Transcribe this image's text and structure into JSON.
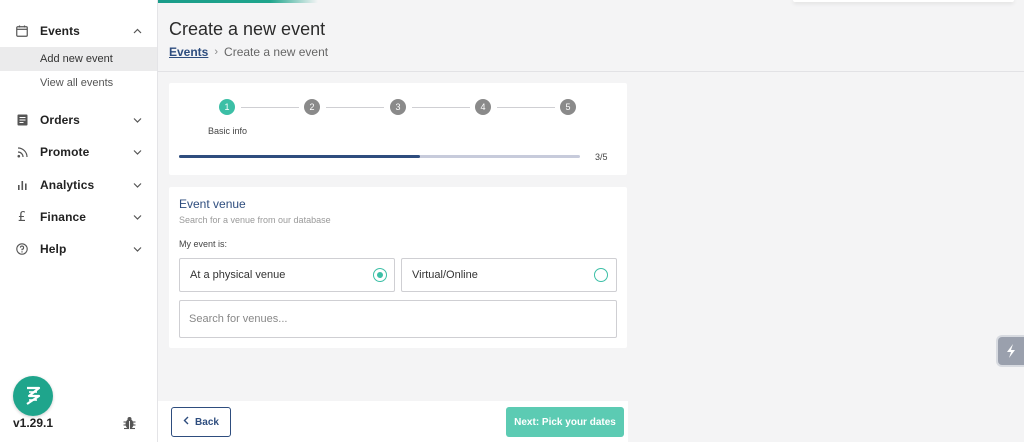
{
  "sidebar": {
    "events": {
      "label": "Events",
      "icon": "calendar-icon",
      "expanded": true,
      "children": [
        {
          "label": "Add new event",
          "active": true
        },
        {
          "label": "View all events",
          "active": false
        }
      ]
    },
    "items": [
      {
        "label": "Orders",
        "icon": "receipt-icon"
      },
      {
        "label": "Promote",
        "icon": "rss-icon"
      },
      {
        "label": "Analytics",
        "icon": "bar-chart-icon"
      },
      {
        "label": "Finance",
        "icon": "pound-icon"
      },
      {
        "label": "Help",
        "icon": "question-circle-icon"
      }
    ],
    "version": "v1.29.1",
    "brand_icon": "brand-logo-icon",
    "bug_icon": "bug-icon"
  },
  "header": {
    "title": "Create a new event",
    "breadcrumb": {
      "link": "Events",
      "separator": "›",
      "current": "Create a new event"
    }
  },
  "stepper": {
    "steps": [
      "1",
      "2",
      "3",
      "4",
      "5"
    ],
    "active_step": 1,
    "active_label": "Basic info",
    "progress_text": "3/5",
    "progress_fraction": 0.6
  },
  "venue": {
    "title": "Event venue",
    "subtitle": "Search for a venue from our database",
    "question": "My event is:",
    "options": [
      {
        "label": "At a physical venue",
        "selected": true
      },
      {
        "label": "Virtual/Online",
        "selected": false
      }
    ],
    "search_placeholder": "Search for venues..."
  },
  "footer": {
    "back_label": "Back",
    "next_label": "Next: Pick your dates"
  },
  "colors": {
    "accent": "#3cbfa6",
    "brand": "#1fa58c",
    "primary_navy": "#2e4d7e",
    "next_button": "#5ccbb3"
  }
}
